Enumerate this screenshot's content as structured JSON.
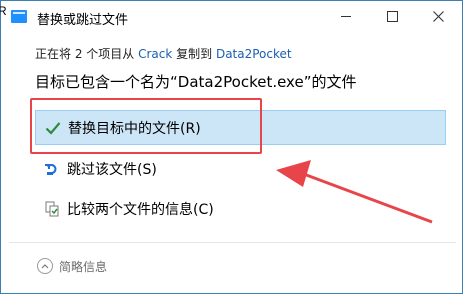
{
  "titlebar": {
    "title": "替换或跳过文件",
    "edge_char": "R"
  },
  "dialog": {
    "source": {
      "prefix": "正在将 2 个项目从 ",
      "from": "Crack",
      "middle": " 复制到 ",
      "to": "Data2Pocket"
    },
    "heading": "目标已包含一个名为“Data2Pocket.exe”的文件",
    "options": {
      "replace": "替换目标中的文件(R)",
      "skip": "跳过该文件(S)",
      "compare": "比较两个文件的信息(C)"
    },
    "footer": {
      "details": "简略信息"
    }
  },
  "colors": {
    "accent": "#1a5fb4",
    "selected_bg": "#cde6f7",
    "annotation": "#e8454a",
    "check": "#2e8b3a"
  }
}
